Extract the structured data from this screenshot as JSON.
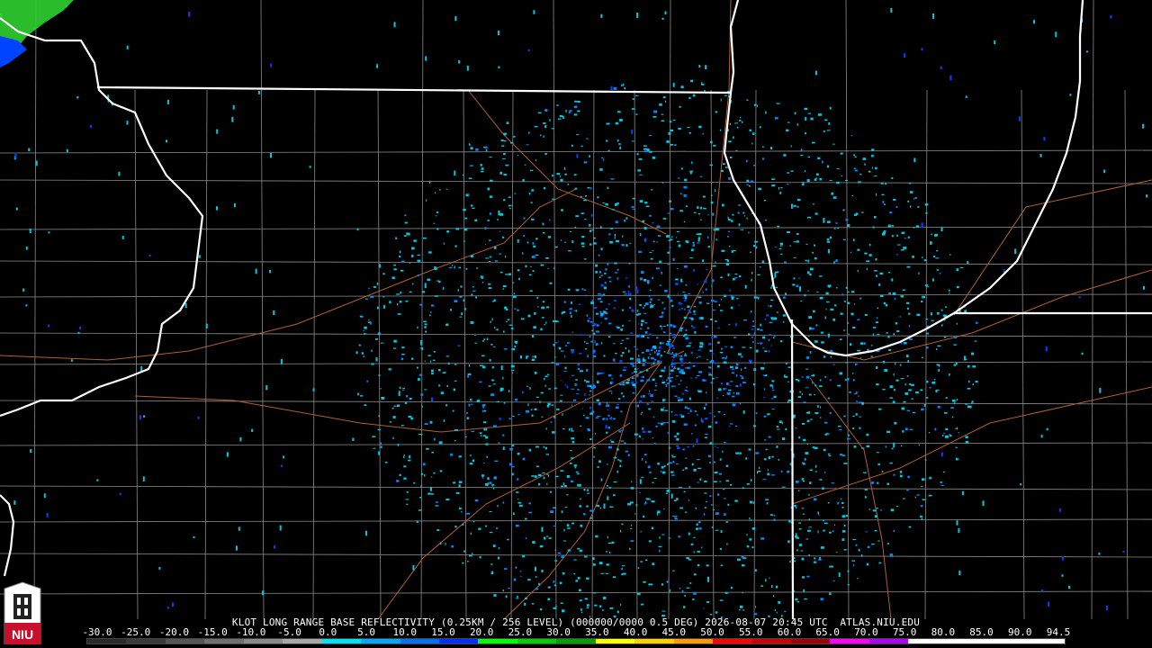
{
  "product_caption": "KLOT LONG RANGE BASE REFLECTIVITY (0.25KM / 256 LEVEL) (000000/0000 0.5 DEG) 2026-08-07 20:45 UTC  ATLAS.NIU.EDU",
  "scale_labels": [
    "-30.0",
    "-25.0",
    "-20.0",
    "-15.0",
    "-10.0",
    "-5.0",
    "0.0",
    "5.0",
    "10.0",
    "15.0",
    "20.0",
    "25.0",
    "30.0",
    "35.0",
    "40.0",
    "45.0",
    "50.0",
    "55.0",
    "60.0",
    "65.0",
    "70.0",
    "75.0",
    "80.0",
    "85.0",
    "90.0",
    "94.5"
  ],
  "scale_colors": [
    "#2a2a2a",
    "#3a3a3a",
    "#555555",
    "#707070",
    "#8a8a8a",
    "#a8a8a8",
    "#00e0f0",
    "#00a8ff",
    "#0070ff",
    "#0030ff",
    "#00ff00",
    "#00d000",
    "#00a000",
    "#ffff00",
    "#ffd000",
    "#ff9a00",
    "#ff0000",
    "#d00000",
    "#a00000",
    "#ff00ff",
    "#b000ff",
    "#ffffff",
    "#ffffff",
    "#ffffff",
    "#ffffff"
  ],
  "logo": {
    "text": "NIU",
    "color": "#c8102e"
  },
  "map_colors": {
    "state_border": "#ffffff",
    "county_line": "#8a8a8a",
    "road": "#b06030",
    "echo_light": "#00c8e0",
    "echo_medium": "#0088ff",
    "echo_dark": "#0044ff",
    "echo_green": "#30d030"
  }
}
